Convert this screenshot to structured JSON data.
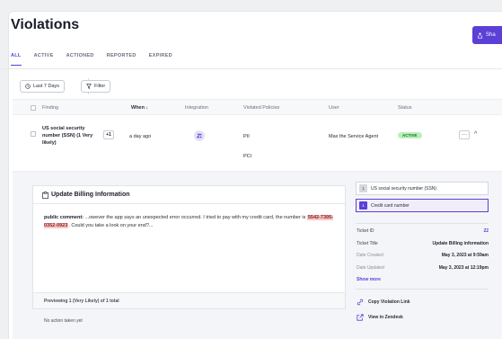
{
  "header": {
    "title": "Violations",
    "share_label": "Sha"
  },
  "tabs": [
    {
      "label": "ALL"
    },
    {
      "label": "ACTIVE"
    },
    {
      "label": "ACTIONED"
    },
    {
      "label": "REPORTED"
    },
    {
      "label": "EXPIRED"
    }
  ],
  "filters": {
    "date_range": "Last 7 Days",
    "filter_label": "Filter"
  },
  "table": {
    "columns": [
      "Finding",
      "When",
      "Integration",
      "Violated Policies",
      "User",
      "Status"
    ],
    "sort_indicator": "↓",
    "row": {
      "finding": "US social security number (SSN) (1 Very likely)",
      "extra_count": "+1",
      "when": "a day ago",
      "integration_icon": "zendesk-icon",
      "policies": [
        "PII",
        "PCI"
      ],
      "user": "Max the Service Agent",
      "status": "ACTIVE",
      "more": "···",
      "collapse": "^"
    }
  },
  "detail": {
    "card_title": "Update Billing Information",
    "comment_label": "public comment:",
    "comment_text_pre": " ...owever the app says an unexpected error occurred. I tried to pay with my credit card, the number is ",
    "comment_highlight": "5542-7395-0352-0923",
    "comment_text_post": ". Could you take a look on your end?...",
    "preview_text": "Previewing 1 (Very Likely) of 1 total",
    "no_action": "No action taken yet",
    "findings": [
      {
        "num": "1",
        "label": "US social security number (SSN)"
      },
      {
        "num": "1",
        "label": "Credit card number"
      }
    ],
    "meta": [
      {
        "key": "Ticket ID",
        "value": "22"
      },
      {
        "key": "Ticket Title",
        "value": "Update Billing information"
      },
      {
        "key": "Date Created",
        "value": "May 3, 2023 at 9:59am"
      },
      {
        "key": "Date Updated",
        "value": "May 3, 2023 at 12:19pm"
      }
    ],
    "show_more": "Show more",
    "copy_link": "Copy Violation Link",
    "view_in": "View in Zendesk"
  },
  "colors": {
    "accent": "#5b3fd6",
    "active_badge": "#b8f0ba",
    "highlight": "#f7c9c9"
  }
}
